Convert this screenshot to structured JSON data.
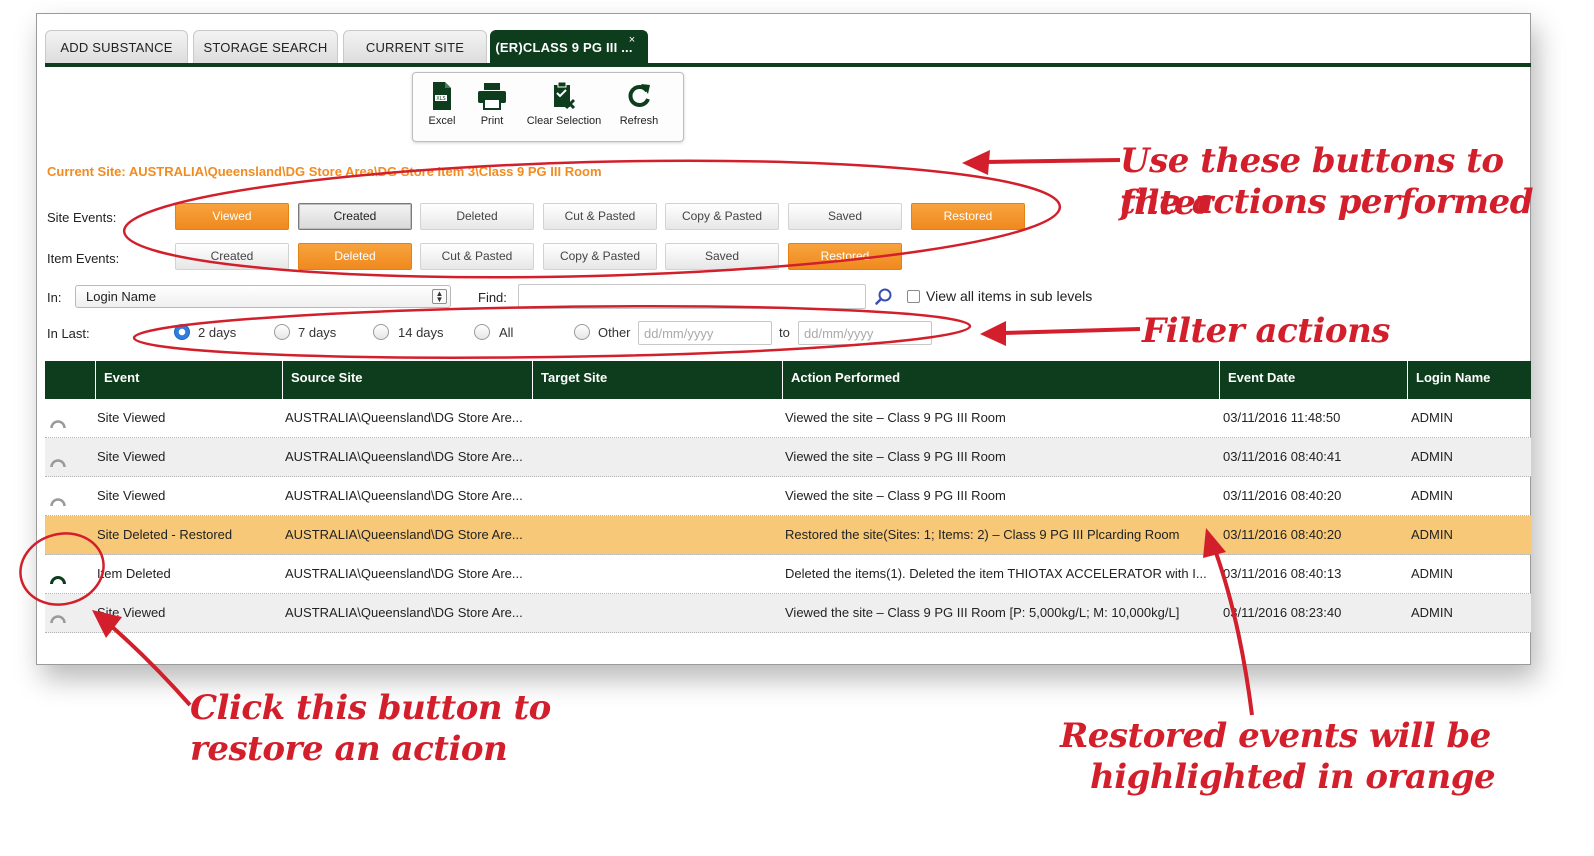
{
  "tabs": [
    {
      "label": "ADD SUBSTANCE"
    },
    {
      "label": "STORAGE SEARCH"
    },
    {
      "label": "CURRENT SITE"
    },
    {
      "label": "(ER)CLASS 9 PG III ...",
      "close": "×"
    }
  ],
  "toolbar": {
    "excel": "Excel",
    "print": "Print",
    "clear": "Clear Selection",
    "refresh": "Refresh"
  },
  "current_site": "Current Site:   AUSTRALIA\\Queensland\\DG Store Area\\DG Store Item 3\\Class 9 PG III Room",
  "site_events": {
    "label": "Site Events:",
    "buttons": [
      "Viewed",
      "Created",
      "Deleted",
      "Cut & Pasted",
      "Copy & Pasted",
      "Saved",
      "Restored"
    ]
  },
  "item_events": {
    "label": "Item Events:",
    "buttons": [
      "Created",
      "Deleted",
      "Cut & Pasted",
      "Copy & Pasted",
      "Saved",
      "Restored"
    ]
  },
  "filters": {
    "in_label": "In:",
    "in_value": "Login Name",
    "find_label": "Find:",
    "subcheck": "View all items in sub levels",
    "inlast_label": "In Last:",
    "options": [
      "2 days",
      "7 days",
      "14 days",
      "All",
      "Other"
    ],
    "selected": "2 days",
    "date_placeholder": "dd/mm/yyyy",
    "to": "to"
  },
  "table": {
    "headers": [
      "Event",
      "Source Site",
      "Target Site",
      "Action Performed",
      "Event Date",
      "Login Name"
    ],
    "rows": [
      {
        "event": "Site Viewed",
        "source": "AUSTRALIA\\Queensland\\DG Store Are...",
        "target": "",
        "action": "Viewed the site – Class 9 PG III Room",
        "date": "03/11/2016 11:48:50",
        "login": "ADMIN"
      },
      {
        "event": "Site Viewed",
        "source": "AUSTRALIA\\Queensland\\DG Store Are...",
        "target": "",
        "action": "Viewed the site – Class 9 PG III Room",
        "date": "03/11/2016 08:40:41",
        "login": "ADMIN"
      },
      {
        "event": "Site Viewed",
        "source": "AUSTRALIA\\Queensland\\DG Store Are...",
        "target": "",
        "action": "Viewed the site – Class 9 PG III Room",
        "date": "03/11/2016 08:40:20",
        "login": "ADMIN"
      },
      {
        "event": "Site Deleted - Restored",
        "source": "AUSTRALIA\\Queensland\\DG Store Are...",
        "target": "",
        "action": "Restored the site(Sites: 1; Items: 2) – Class 9 PG III Plcarding Room",
        "date": "03/11/2016 08:40:20",
        "login": "ADMIN"
      },
      {
        "event": "Item Deleted",
        "source": "AUSTRALIA\\Queensland\\DG Store Are...",
        "target": "",
        "action": "Deleted the items(1). Deleted the item THIOTAX ACCELERATOR with I...",
        "date": "03/11/2016 08:40:13",
        "login": "ADMIN"
      },
      {
        "event": "Site Viewed",
        "source": "AUSTRALIA\\Queensland\\DG Store Are...",
        "target": "",
        "action": "Viewed the site – Class 9 PG III Room [P: 5,000kg/L; M: 10,000kg/L]",
        "date": "03/11/2016 08:23:40",
        "login": "ADMIN"
      }
    ]
  },
  "annotations": {
    "filter_buttons_1": "Use these buttons to filter",
    "filter_buttons_2": "the actions performed",
    "filter_actions": "Filter actions",
    "restore_1": "Click this button to",
    "restore_2": "restore an action",
    "highlight_1": "Restored events will be",
    "highlight_2": "highlighted in orange"
  },
  "colors": {
    "header_green": "#0e3d1d",
    "accent_orange": "#ef8a1e",
    "highlight_row": "#f7c877",
    "annotation_red": "#d21f2b"
  }
}
